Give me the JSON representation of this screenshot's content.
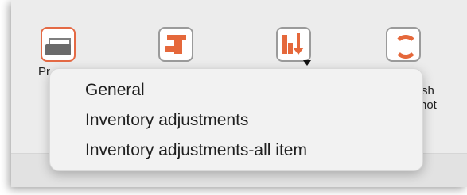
{
  "toolbar": {
    "print_label_fragment": "Pr",
    "refresh_label_line1_fragment": "sh",
    "refresh_label_line2_fragment": "hot"
  },
  "print_menu": {
    "items": [
      {
        "label": "General"
      },
      {
        "label": "Inventory adjustments"
      },
      {
        "label": "Inventory adjustments-all item"
      }
    ]
  },
  "icons": {
    "print": "printer-icon",
    "second": "dispatch-icon",
    "third": "sort-icon",
    "refresh": "refresh-icon"
  },
  "colors": {
    "accent": "#e5683b"
  }
}
